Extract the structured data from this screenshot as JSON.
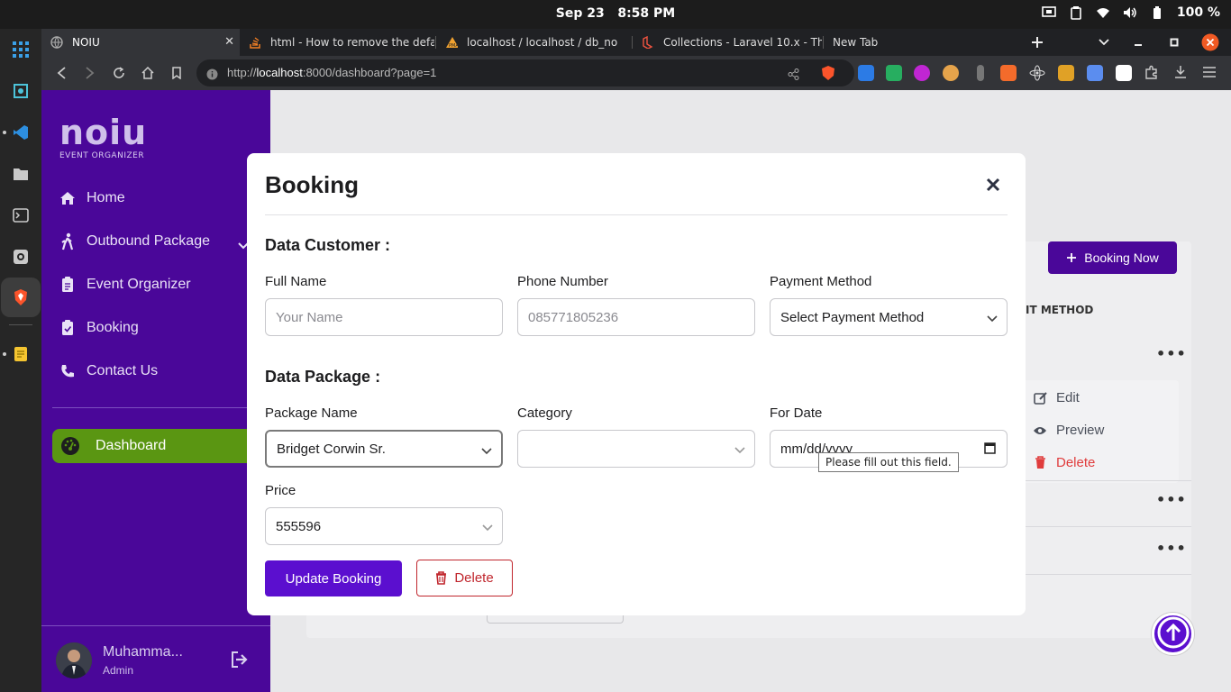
{
  "system": {
    "date": "Sep 23",
    "time": "8:58 PM",
    "battery": "100 %"
  },
  "browser": {
    "tabs": [
      {
        "label": "NOIU",
        "active": true
      },
      {
        "label": "html - How to remove the defa",
        "active": false
      },
      {
        "label": "localhost / localhost / db_no",
        "active": false
      },
      {
        "label": "Collections - Laravel 10.x - The",
        "active": false
      },
      {
        "label": "New Tab",
        "active": false
      }
    ],
    "url_prefix": "http://",
    "url_host": "localhost",
    "url_rest": ":8000/dashboard?page=1"
  },
  "sidebar": {
    "logo": "noiu",
    "logo_sub": "EVENT ORGANIZER",
    "items": [
      {
        "label": "Home",
        "icon": "home-icon"
      },
      {
        "label": "Outbound Package",
        "icon": "hiking-icon"
      },
      {
        "label": "Event Organizer",
        "icon": "clipboard-icon"
      },
      {
        "label": "Booking",
        "icon": "clipboard-check-icon"
      },
      {
        "label": "Contact Us",
        "icon": "phone-icon"
      }
    ],
    "dashboard": "Dashboard",
    "user_name": "Muhamma...",
    "user_role": "Admin"
  },
  "background": {
    "book_now": "Booking Now",
    "col_header": "IT METHOD",
    "menu": {
      "edit": "Edit",
      "preview": "Preview",
      "delete": "Delete"
    }
  },
  "modal": {
    "title": "Booking",
    "section_customer": "Data Customer :",
    "section_package": "Data Package :",
    "full_name": {
      "label": "Full Name",
      "placeholder": "Your Name"
    },
    "phone": {
      "label": "Phone Number",
      "value": "085771805236"
    },
    "payment": {
      "label": "Payment Method",
      "value": "Select Payment Method"
    },
    "package": {
      "label": "Package Name",
      "value": "Bridget Corwin Sr."
    },
    "category": {
      "label": "Category",
      "value": ""
    },
    "date": {
      "label": "For Date",
      "value": "mm/dd/yyyy"
    },
    "price": {
      "label": "Price",
      "value": "555596"
    },
    "tooltip": "Please fill out this field.",
    "update_btn": "Update Booking",
    "delete_btn": "Delete"
  },
  "colors": {
    "sidebar": "#4a0799",
    "accent": "#5b0fcf",
    "dashboard_active": "#5a9612",
    "danger": "#c0262d"
  }
}
